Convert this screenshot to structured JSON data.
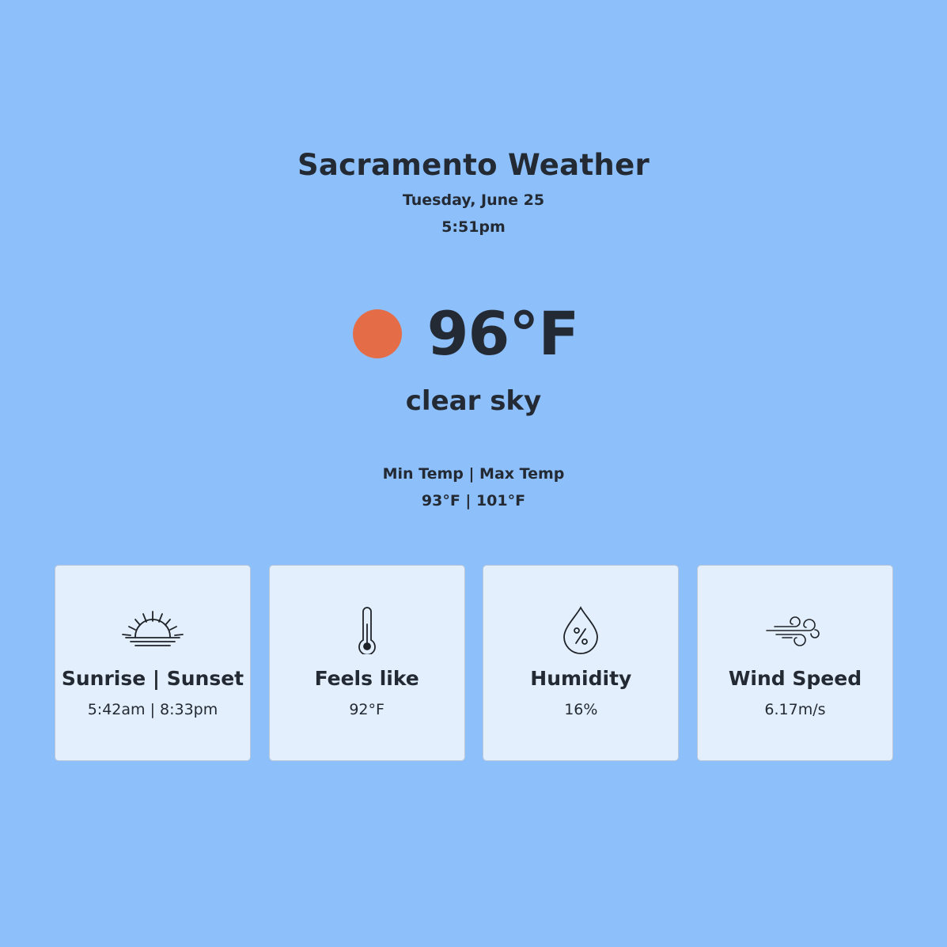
{
  "header": {
    "title": "Sacramento Weather",
    "date": "Tuesday, June 25",
    "time": "5:51pm"
  },
  "current": {
    "icon": "sun-icon",
    "icon_color": "#e46d47",
    "temperature": "96°F",
    "condition": "clear sky"
  },
  "min_max": {
    "label": "Min Temp | Max Temp",
    "value": "93°F | 101°F"
  },
  "cards": [
    {
      "icon": "sunrise-icon",
      "title": "Sunrise | Sunset",
      "value": "5:42am | 8:33pm"
    },
    {
      "icon": "thermometer-icon",
      "title": "Feels like",
      "value": "92°F"
    },
    {
      "icon": "humidity-drop-icon",
      "title": "Humidity",
      "value": "16%"
    },
    {
      "icon": "wind-icon",
      "title": "Wind Speed",
      "value": "6.17m/s"
    }
  ],
  "colors": {
    "background": "#8dc0fb",
    "card_background": "#e3effd",
    "text": "#242a33"
  }
}
